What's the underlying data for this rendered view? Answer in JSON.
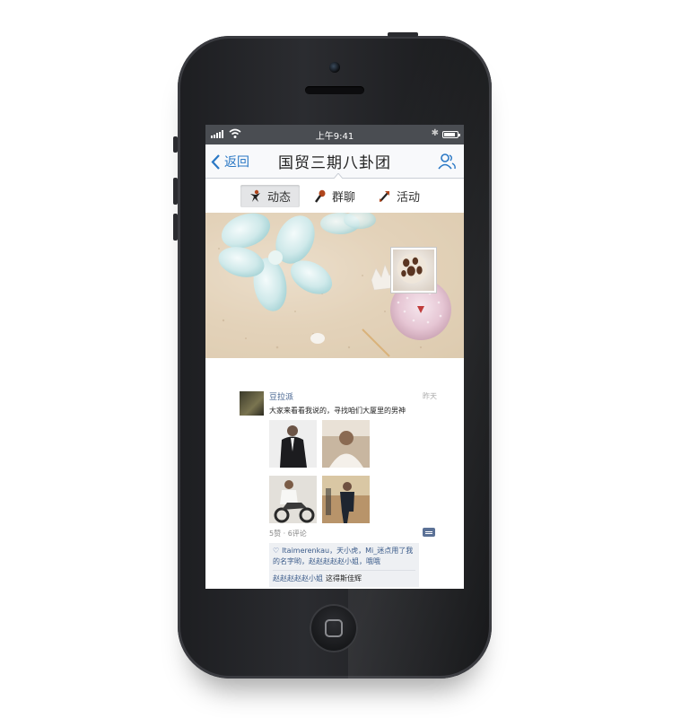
{
  "status_bar": {
    "time": "上午9:41"
  },
  "nav": {
    "back_label": "返回",
    "title": "国贸三期八卦团"
  },
  "tabs": [
    {
      "label": "动态",
      "active": true,
      "icon": "person-icon"
    },
    {
      "label": "群聊",
      "active": false,
      "icon": "mic-icon"
    },
    {
      "label": "活动",
      "active": false,
      "icon": "arrow-icon"
    }
  ],
  "post": {
    "author": "豆拉派",
    "time": "昨天",
    "text": "大家来看看我说的，寻找咱们大厦里的男神",
    "meta": "5赞 · 6评论",
    "likes": "Itaimerenkau，天小虎，Mi_迷点用了我的名字哟，赵赵赵赵赵小姐，哦哦",
    "comment_author": "赵赵赵赵赵小姐",
    "comment_text": "这得斯佳辉"
  },
  "colors": {
    "accent": "#2a78c5",
    "link": "#3b5b8a",
    "status_bar": "#4a4d52"
  }
}
